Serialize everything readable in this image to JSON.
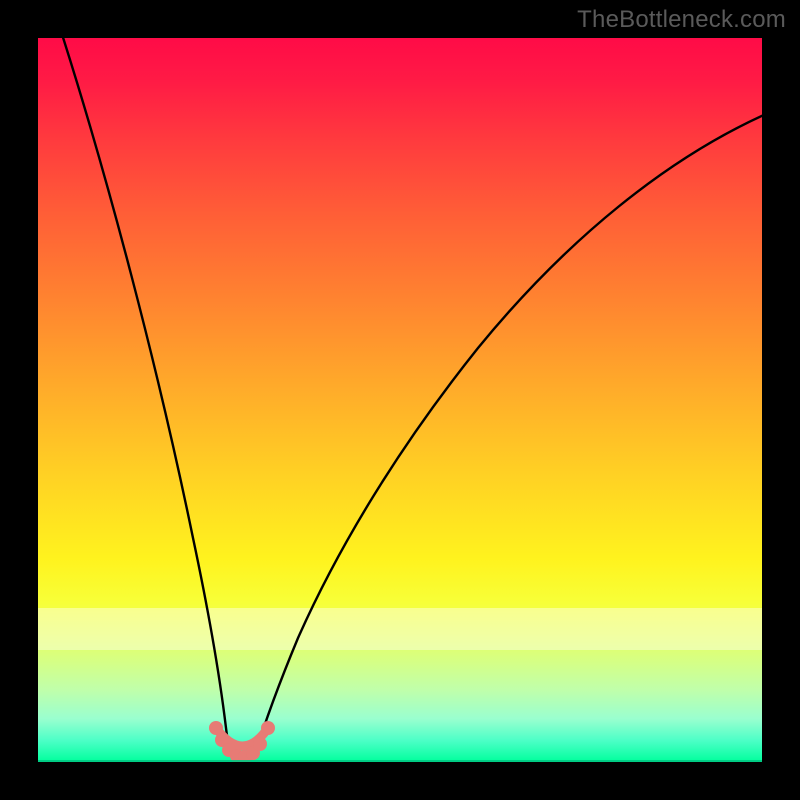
{
  "watermark": {
    "text": "TheBottleneck.com"
  },
  "chart_data": {
    "type": "line",
    "title": "",
    "xlabel": "",
    "ylabel": "",
    "xlim": [
      0,
      100
    ],
    "ylim": [
      0,
      100
    ],
    "grid": false,
    "legend": false,
    "background_gradient": {
      "direction": "vertical",
      "stops": [
        {
          "pos": 0,
          "color": "#ff0b47"
        },
        {
          "pos": 24,
          "color": "#ff5d37"
        },
        {
          "pos": 48,
          "color": "#ffaa2a"
        },
        {
          "pos": 72,
          "color": "#fff31e"
        },
        {
          "pos": 90,
          "color": "#c0ffaa"
        },
        {
          "pos": 100,
          "color": "#00ff9c"
        }
      ]
    },
    "series": [
      {
        "name": "left-curve",
        "color": "#000000",
        "x": [
          3,
          6,
          10,
          14,
          18,
          21,
          23,
          24.5,
          25.3,
          25.8
        ],
        "y": [
          100,
          83,
          62,
          43,
          27,
          15,
          7,
          3,
          1,
          0.3
        ]
      },
      {
        "name": "right-curve",
        "color": "#000000",
        "x": [
          29.2,
          30,
          31.5,
          34,
          38,
          44,
          52,
          62,
          74,
          88,
          100
        ],
        "y": [
          0.3,
          1.2,
          4,
          9,
          17,
          28,
          41,
          55,
          68,
          80,
          89
        ]
      },
      {
        "name": "trough-marker",
        "color": "#e77b75",
        "type": "scatter-line",
        "x": [
          24.0,
          24.8,
          25.4,
          26.2,
          27.0,
          27.8,
          28.6,
          29.4,
          30.2,
          30.8
        ],
        "y": [
          4.8,
          2.9,
          1.6,
          0.8,
          0.5,
          0.5,
          0.8,
          1.6,
          2.9,
          4.8
        ]
      }
    ],
    "annotations": []
  }
}
